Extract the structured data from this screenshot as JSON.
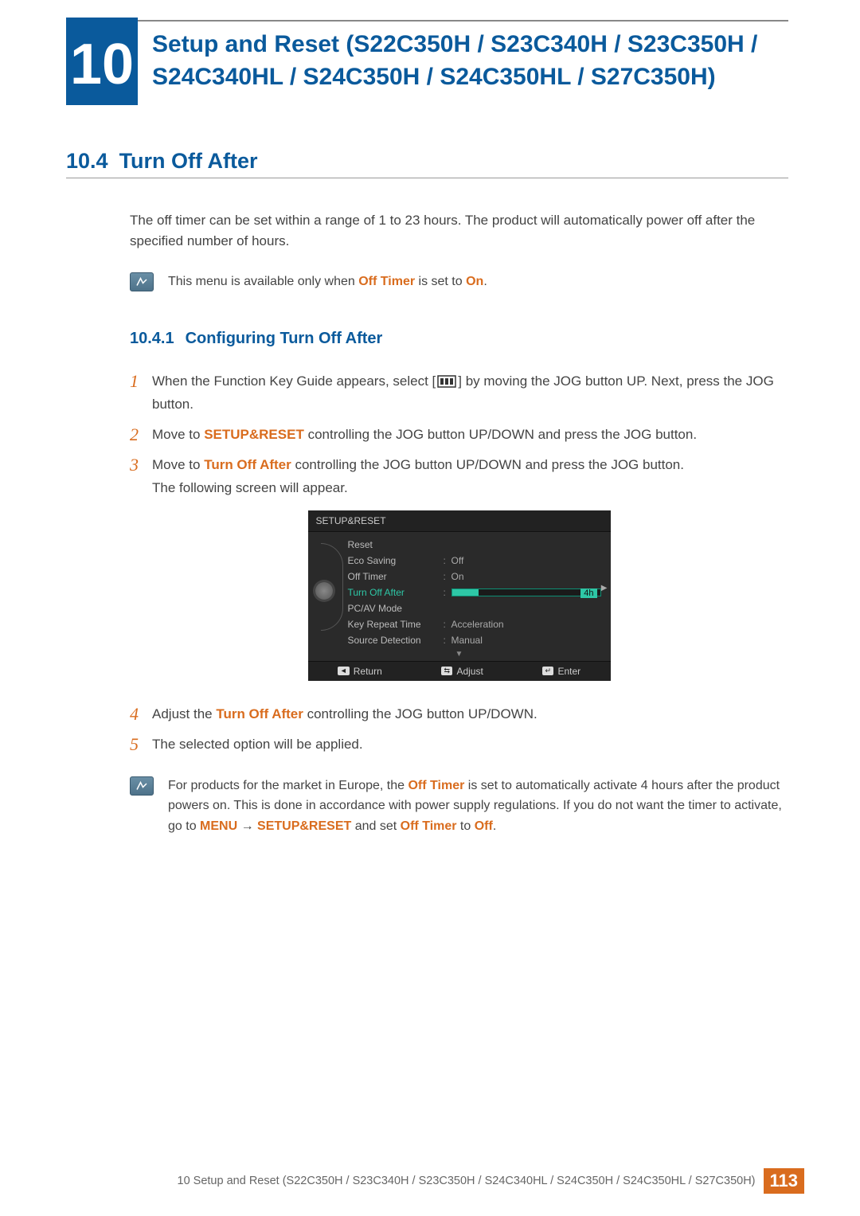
{
  "chapter": {
    "number": "10",
    "title": "Setup and Reset (S22C350H / S23C340H / S23C350H / S24C340HL / S24C350H / S24C350HL / S27C350H)"
  },
  "section": {
    "number": "10.4",
    "title": "Turn Off After",
    "intro": "The off timer can be set within a range of 1 to 23 hours. The product will automatically power off after the specified number of hours."
  },
  "note1": {
    "pre": "This menu is available only when ",
    "em1": "Off Timer",
    "mid": " is set to ",
    "em2": "On",
    "post": "."
  },
  "subsection": {
    "number": "10.4.1",
    "title": "Configuring Turn Off After"
  },
  "steps": {
    "s1a": "When the Function Key Guide appears, select [",
    "s1b": "] by moving the JOG button UP. Next, press the JOG button.",
    "s2a": "Move to ",
    "s2em": "SETUP&RESET",
    "s2b": " controlling the JOG button UP/DOWN and press the JOG button.",
    "s3a": "Move to ",
    "s3em": "Turn Off After",
    "s3b": " controlling the JOG button UP/DOWN and press the JOG button.",
    "s3c": "The following screen will appear.",
    "s4a": "Adjust the ",
    "s4em": "Turn Off After",
    "s4b": " controlling the JOG button UP/DOWN.",
    "s5": "The selected option will be applied."
  },
  "osd": {
    "title": "SETUP&RESET",
    "rows": [
      {
        "label": "Reset",
        "value": ""
      },
      {
        "label": "Eco Saving",
        "value": "Off"
      },
      {
        "label": "Off Timer",
        "value": "On"
      },
      {
        "label": "Turn Off After",
        "value": "4h",
        "selected": true,
        "slider": true
      },
      {
        "label": "PC/AV Mode",
        "value": ""
      },
      {
        "label": "Key Repeat Time",
        "value": "Acceleration"
      },
      {
        "label": "Source Detection",
        "value": "Manual"
      }
    ],
    "footer": {
      "return": "Return",
      "adjust": "Adjust",
      "enter": "Enter"
    }
  },
  "note2": {
    "t1": "For products for the market in Europe, the ",
    "em1": "Off Timer",
    "t2": " is set to automatically activate 4 hours after the product powers on. This is done in accordance with power supply regulations. If you do not want the timer to activate, go to ",
    "em2": "MENU",
    "arrow": " → ",
    "em3": "SETUP&RESET",
    "t3": " and set ",
    "em4": "Off Timer",
    "t4": " to ",
    "em5": "Off",
    "t5": "."
  },
  "footer": {
    "text": "10 Setup and Reset (S22C350H / S23C340H / S23C350H / S24C340HL / S24C350H / S24C350HL / S27C350H)",
    "page": "113"
  }
}
